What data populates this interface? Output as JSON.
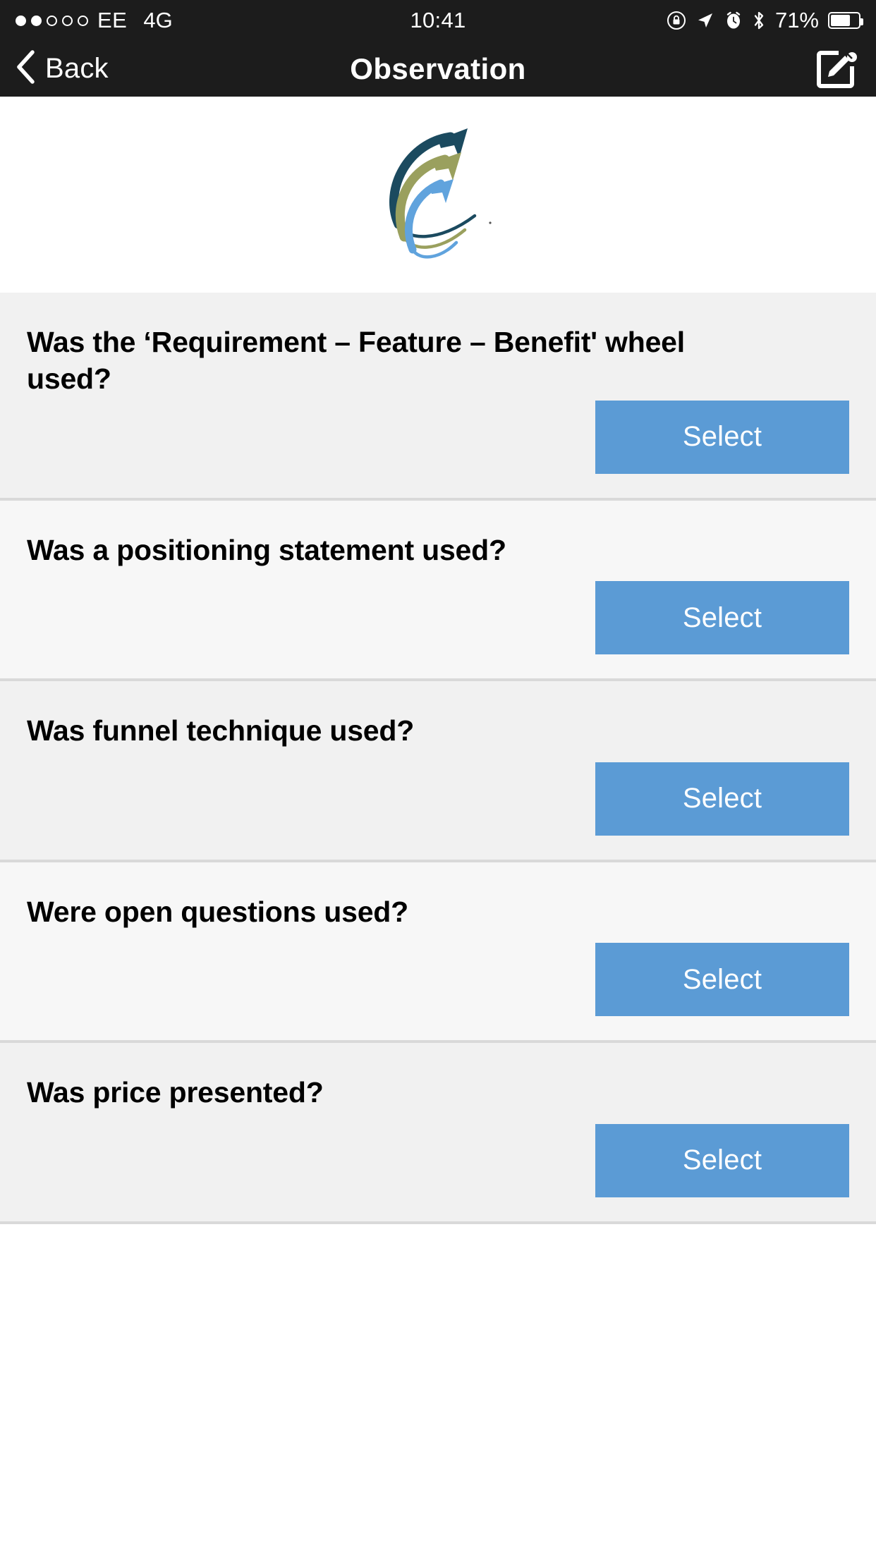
{
  "status_bar": {
    "signal_dots_total": 5,
    "signal_dots_filled": 2,
    "carrier": "EE",
    "network": "4G",
    "time": "10:41",
    "battery_percent": "71%",
    "battery_level": 71,
    "icons": [
      "rotation-lock-icon",
      "location-arrow-icon",
      "alarm-clock-icon",
      "bluetooth-icon"
    ]
  },
  "nav": {
    "back_label": "Back",
    "title": "Observation",
    "compose_icon": "compose-edit-icon"
  },
  "logo": {
    "name": "three-arrows-swoosh-logo",
    "colors": {
      "dark": "#1b4a5f",
      "olive": "#9aa05e",
      "blue": "#60a3dd"
    }
  },
  "theme": {
    "accent": "#5b9bd5",
    "bar_background": "#1c1c1c",
    "row_odd": "#f1f1f1",
    "row_even": "#f7f7f7",
    "separator": "#d9d9d9"
  },
  "questions": [
    {
      "text": "Was the ‘Requirement – Feature – Benefit' wheel used?",
      "button_label": "Select",
      "lines": 2
    },
    {
      "text": "Was a positioning statement used?",
      "button_label": "Select",
      "lines": 1
    },
    {
      "text": "Was funnel technique used?",
      "button_label": "Select",
      "lines": 1
    },
    {
      "text": "Were open questions used?",
      "button_label": "Select",
      "lines": 1
    },
    {
      "text": "Was price presented?",
      "button_label": "Select",
      "lines": 1
    }
  ]
}
